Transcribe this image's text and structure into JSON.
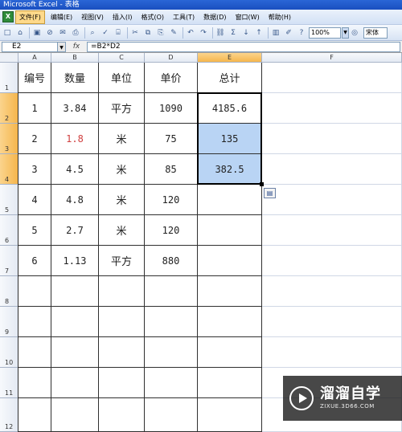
{
  "window": {
    "title": "Microsoft Excel - 表格"
  },
  "menu": {
    "app_icon": "X",
    "items": [
      "文件(F)",
      "编辑(E)",
      "视图(V)",
      "插入(I)",
      "格式(O)",
      "工具(T)",
      "数据(D)",
      "窗口(W)",
      "帮助(H)"
    ],
    "active_index": 0
  },
  "toolbar": {
    "icons": [
      "new-icon",
      "open-icon",
      "save-icon",
      "permission-icon",
      "email-icon",
      "print-icon",
      "print-preview-icon",
      "spelling-icon",
      "research-icon",
      "cut-icon",
      "copy-icon",
      "paste-icon",
      "format-painter-icon",
      "undo-icon",
      "redo-icon",
      "hyperlink-icon",
      "autosum-icon",
      "sort-ascending-icon",
      "sort-descending-icon",
      "chart-wizard-icon",
      "drawing-icon",
      "help-icon"
    ],
    "glyphs": [
      "□",
      "⌂",
      "▣",
      "⊘",
      "✉",
      "⎙",
      "⌕",
      "✓",
      "⌸",
      "✂",
      "⧉",
      "⎘",
      "✎",
      "↶",
      "↷",
      "⛓",
      "Σ",
      "↓",
      "↑",
      "▥",
      "✐",
      "?"
    ],
    "zoom": "100%",
    "font": "宋体"
  },
  "formula_bar": {
    "name_box": "E2",
    "fx_label": "fx",
    "formula": "=B2*D2"
  },
  "columns": [
    "A",
    "B",
    "C",
    "D",
    "E",
    "F"
  ],
  "rows": [
    "1",
    "2",
    "3",
    "4",
    "5",
    "6",
    "7",
    "8",
    "9",
    "10",
    "11",
    "12"
  ],
  "table": {
    "headers": [
      "编号",
      "数量",
      "单位",
      "单价",
      "总计"
    ],
    "rows": [
      [
        "1",
        "3.84",
        "平方",
        "1090",
        "4185.6"
      ],
      [
        "2",
        "1.8",
        "米",
        "75",
        "135"
      ],
      [
        "3",
        "4.5",
        "米",
        "85",
        "382.5"
      ],
      [
        "4",
        "4.8",
        "米",
        "120",
        ""
      ],
      [
        "5",
        "2.7",
        "米",
        "120",
        ""
      ],
      [
        "6",
        "1.13",
        "平方",
        "880",
        ""
      ]
    ]
  },
  "colors": {
    "accent_selection": "#b9d4f4",
    "header_selected": "#f5b64d",
    "red_text": "#d04040"
  },
  "watermark": {
    "title": "溜溜自学",
    "url": "ZIXUE.3D66.COM"
  }
}
